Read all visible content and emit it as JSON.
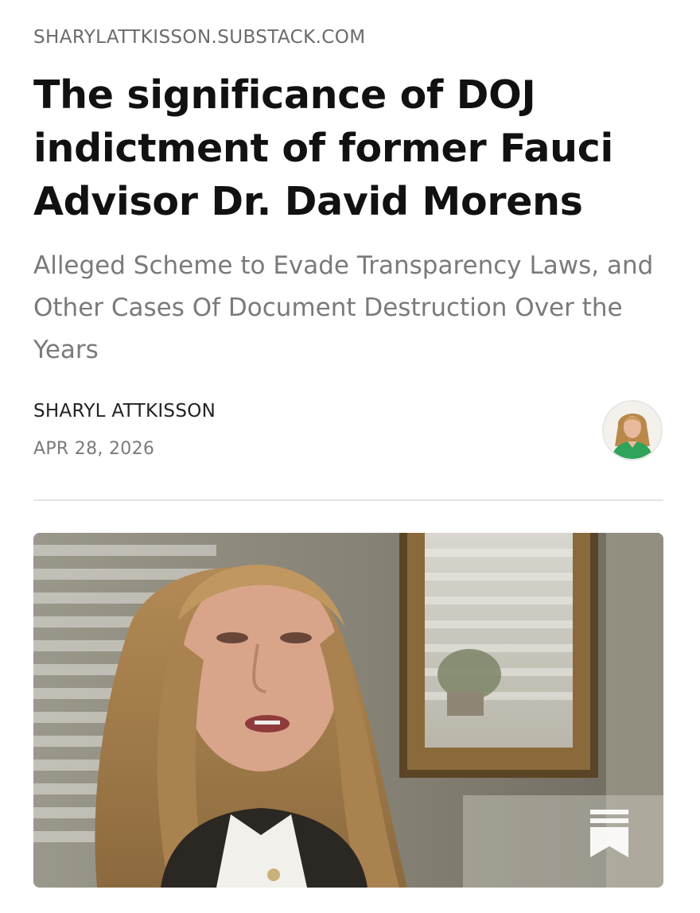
{
  "article": {
    "source": "SHARYLATTKISSON.SUBSTACK.COM",
    "title": "The significance of DOJ indictment of former Fauci Advisor Dr. David Morens",
    "subtitle": "Alleged Scheme to Evade Transparency Laws, and Other Cases Of Document Destruction Over the Years",
    "author": "SHARYL ATTKISSON",
    "date": "APR 28, 2026"
  },
  "icons": {
    "author_avatar": "author-avatar",
    "bookmark": "bookmark-icon"
  },
  "colors": {
    "title": "#111111",
    "subtitle": "#7a7a7a",
    "source": "#6b6b6b",
    "divider": "#e3e3e3",
    "avatar_top": "#2fa35a"
  }
}
